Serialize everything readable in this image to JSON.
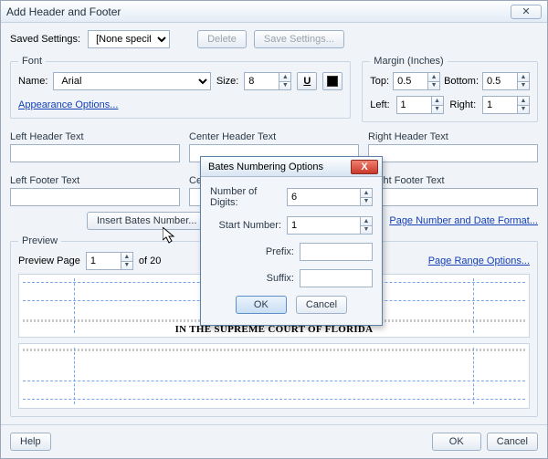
{
  "window": {
    "title": "Add Header and Footer"
  },
  "savedSettings": {
    "label": "Saved Settings:",
    "value": "[None specified]",
    "deleteLabel": "Delete",
    "saveLabel": "Save Settings..."
  },
  "font": {
    "legend": "Font",
    "nameLabel": "Name:",
    "nameValue": "Arial",
    "sizeLabel": "Size:",
    "sizeValue": "8",
    "underlineIcon": "U",
    "appearanceLink": "Appearance Options..."
  },
  "margin": {
    "legend": "Margin (Inches)",
    "topLabel": "Top:",
    "topValue": "0.5",
    "bottomLabel": "Bottom:",
    "bottomValue": "0.5",
    "leftLabel": "Left:",
    "leftValue": "1",
    "rightLabel": "Right:",
    "rightValue": "1"
  },
  "headers": {
    "leftHeader": "Left Header Text",
    "centerHeader": "Center Header Text",
    "rightHeader": "Right Header Text",
    "leftFooter": "Left Footer Text",
    "centerFooter": "Center Footer Text",
    "rightFooter": "Right Footer Text"
  },
  "actions": {
    "insertBates": "Insert Bates Number...",
    "pageDateLink": "Page Number and Date Format...",
    "pageRangeLink": "Page Range Options..."
  },
  "preview": {
    "legend": "Preview",
    "pageLabel": "Preview Page",
    "pageValue": "1",
    "ofLabel": "of 20",
    "docTitle": "IN THE SUPREME COURT OF FLORIDA"
  },
  "bottom": {
    "help": "Help",
    "ok": "OK",
    "cancel": "Cancel"
  },
  "modal": {
    "title": "Bates Numbering Options",
    "numDigitsLabel": "Number of Digits:",
    "numDigitsValue": "6",
    "startLabel": "Start Number:",
    "startValue": "1",
    "prefixLabel": "Prefix:",
    "prefixValue": "",
    "suffixLabel": "Suffix:",
    "suffixValue": "",
    "ok": "OK",
    "cancel": "Cancel"
  }
}
